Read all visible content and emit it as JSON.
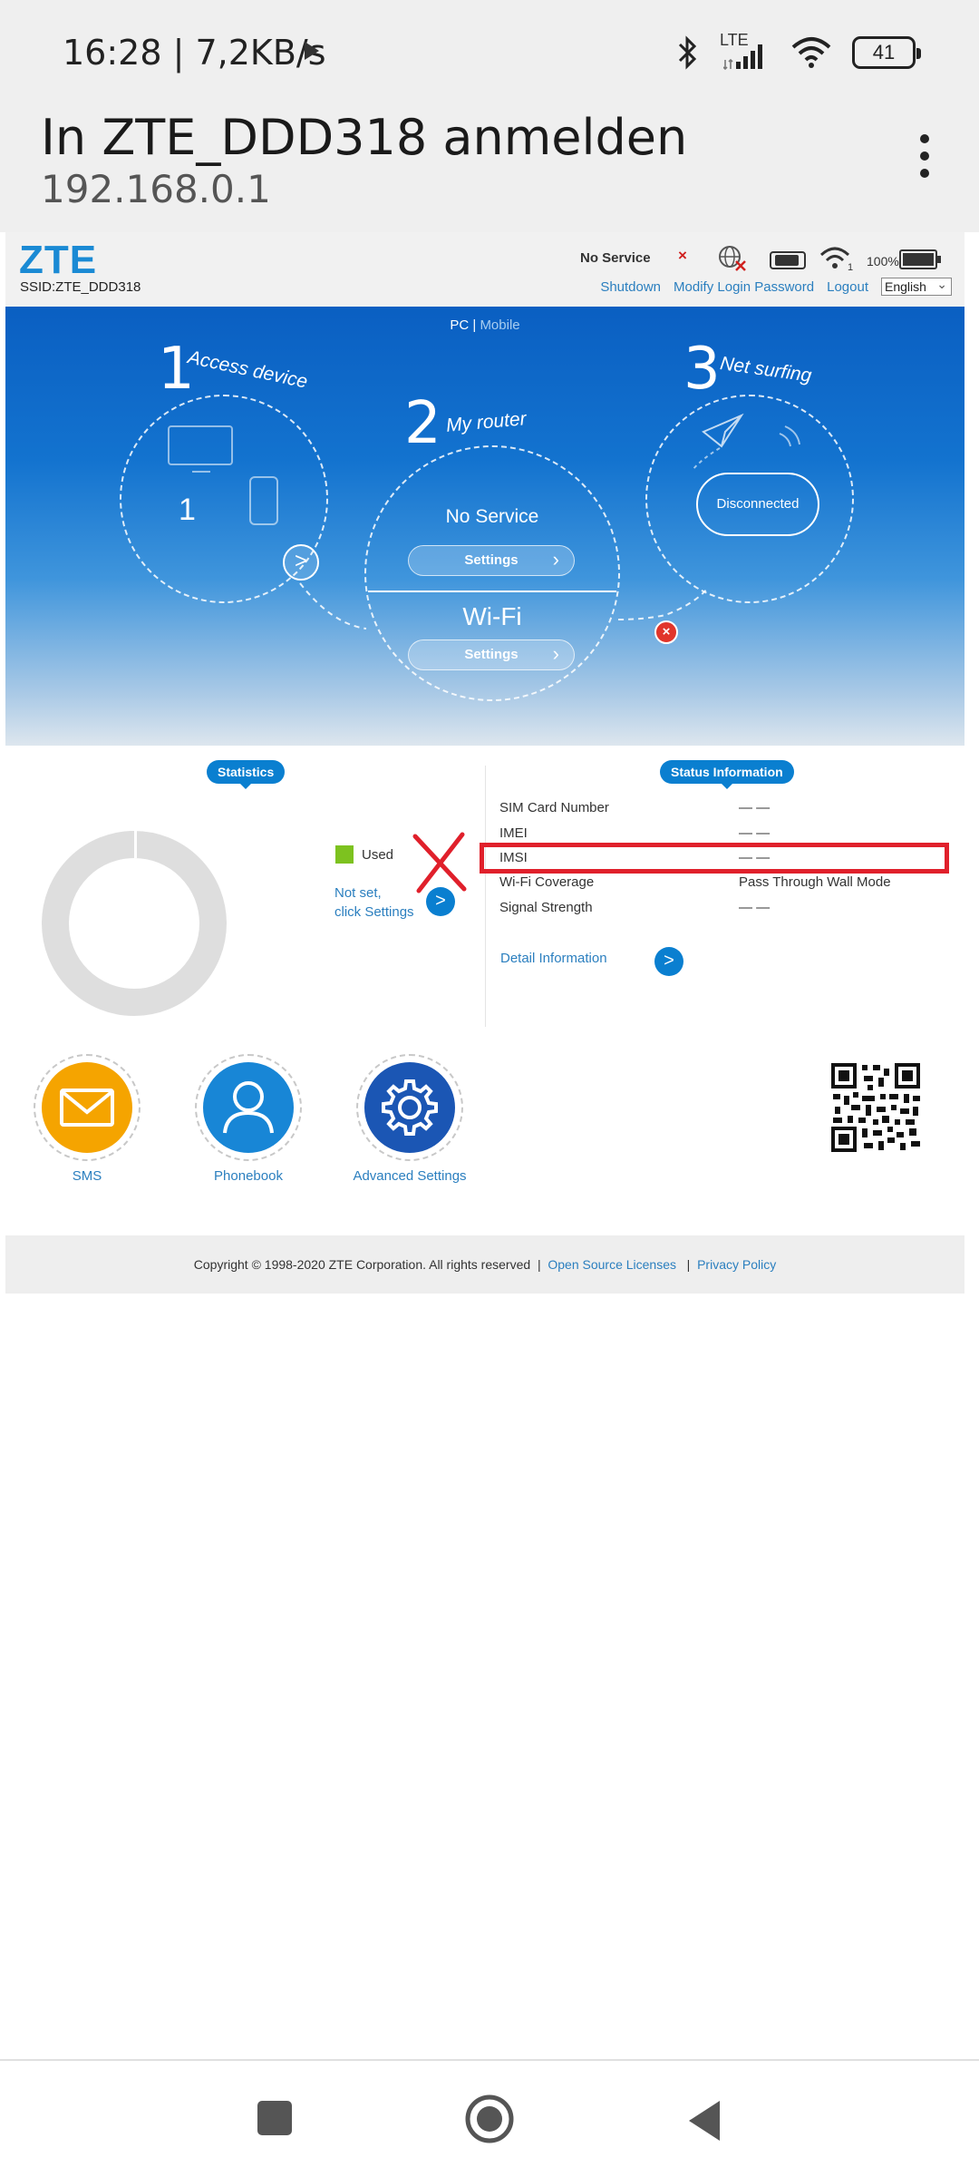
{
  "status_bar": {
    "time": "16:28 | 7,2KB/s",
    "network": "LTE",
    "battery": "41",
    "icons": [
      "play-icon",
      "bluetooth-icon",
      "signal-icon",
      "wifi-icon",
      "battery-icon"
    ]
  },
  "browser": {
    "title": "In ZTE_DDD318 anmelden",
    "url": "192.168.0.1"
  },
  "router_header": {
    "logo": "ZTE",
    "ssid": "SSID:ZTE_DDD318",
    "status": "No Service",
    "status_mark": "×",
    "battery_pct": "100%",
    "links": [
      "Shutdown",
      "Modify Login Password",
      "Logout"
    ],
    "language": "English"
  },
  "banner": {
    "view_pc": "PC",
    "view_sep": " | ",
    "view_mobile": "Mobile",
    "step1": {
      "num": "1",
      "label": "Access device",
      "count": "1"
    },
    "step2": {
      "num": "2",
      "label": "My router",
      "status": "No Service",
      "settings": "Settings",
      "wifi": "Wi-Fi",
      "wifi_settings": "Settings"
    },
    "step3": {
      "num": "3",
      "label": "Net surfing",
      "state": "Disconnected"
    },
    "arrow": ">",
    "error_mark": "×"
  },
  "statistics": {
    "tag": "Statistics",
    "legend_used": "Used",
    "not_set_line1": "Not set,",
    "not_set_line2": "click Settings",
    "arrow": ">"
  },
  "status_info": {
    "tag": "Status Information",
    "rows": [
      {
        "key": "SIM Card Number",
        "value": "— —"
      },
      {
        "key": "IMEI",
        "value": "— —"
      },
      {
        "key": "IMSI",
        "value": "— —"
      },
      {
        "key": "Wi-Fi Coverage",
        "value": "Pass Through Wall Mode"
      },
      {
        "key": "Signal Strength",
        "value": "— —"
      }
    ],
    "detail": "Detail Information",
    "arrow": ">"
  },
  "shortcuts": [
    {
      "label": "SMS",
      "color": "#f5a400"
    },
    {
      "label": "Phonebook",
      "color": "#1886d6"
    },
    {
      "label": "Advanced Settings",
      "color": "#1b56b4"
    }
  ],
  "footer": {
    "copyright": "Copyright © 1998-2020 ZTE Corporation. All rights reserved",
    "sep": "|",
    "open_source": "Open Source Licenses",
    "privacy": "Privacy Policy"
  },
  "colors": {
    "zte_blue": "#1a8ad4",
    "link_blue": "#2b7fbf",
    "annotation_red": "#e0202b",
    "used_green": "#7dc21f"
  }
}
